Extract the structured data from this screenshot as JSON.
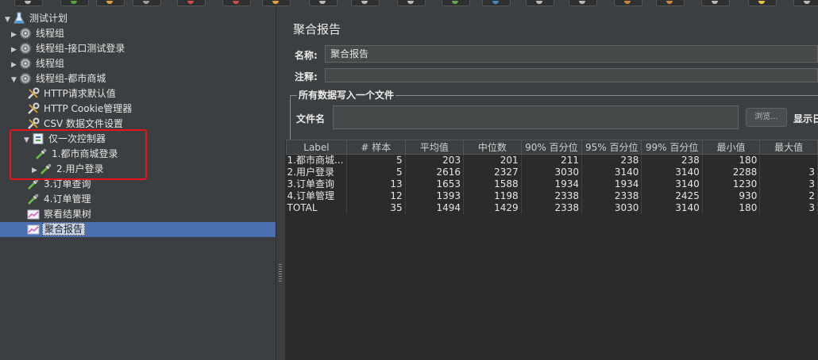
{
  "toolbar": {
    "buttons": [
      {
        "name": "new-plan-button",
        "accent": "#bbbbbb"
      },
      {
        "name": "templates-button",
        "accent": "#56a83a"
      },
      {
        "name": "open-button",
        "accent": "#d7a430"
      },
      {
        "name": "save-button",
        "accent": "#9a9a9a"
      },
      {
        "name": "cut-button",
        "accent": "#d14d4d"
      },
      {
        "name": "copy-button",
        "accent": "#d14d4d"
      },
      {
        "name": "paste-button",
        "accent": "#e2a43a"
      },
      {
        "name": "expand-button",
        "accent": "#bbbbbb"
      },
      {
        "name": "collapse-button",
        "accent": "#bbbbbb"
      },
      {
        "name": "toggle-button",
        "accent": "#bbbbbb"
      },
      {
        "name": "start-button",
        "accent": "#6aa84f"
      },
      {
        "name": "start-no-pause-button",
        "accent": "#4a86c8"
      },
      {
        "name": "stop-button",
        "accent": "#bbbbbb"
      },
      {
        "name": "shutdown-button",
        "accent": "#bbbbbb"
      },
      {
        "name": "clear-button",
        "accent": "#c88a3a"
      },
      {
        "name": "clear-all-button",
        "accent": "#c88a3a"
      },
      {
        "name": "search-button",
        "accent": "#bbbbbb"
      },
      {
        "name": "function-helper-button",
        "accent": "#e5c542"
      },
      {
        "name": "help-button",
        "accent": "#bbbbbb"
      }
    ]
  },
  "tree": {
    "items": [
      {
        "label": "测试计划",
        "icon": "test-plan-icon",
        "arrow": "expanded",
        "indent": 0
      },
      {
        "label": "线程组",
        "icon": "gear-icon",
        "arrow": "collapsed",
        "indent": 1
      },
      {
        "label": "线程组-接口测试登录",
        "icon": "gear-icon",
        "arrow": "collapsed",
        "indent": 1
      },
      {
        "label": "线程组",
        "icon": "gear-icon",
        "arrow": "collapsed",
        "indent": 1
      },
      {
        "label": "线程组-都市商城",
        "icon": "gear-icon",
        "arrow": "expanded",
        "indent": 1
      },
      {
        "label": "HTTP请求默认值",
        "icon": "wrench-icon",
        "arrow": "none",
        "indent": 2
      },
      {
        "label": "HTTP Cookie管理器",
        "icon": "wrench-icon",
        "arrow": "none",
        "indent": 2
      },
      {
        "label": "CSV 数据文件设置",
        "icon": "wrench-icon",
        "arrow": "none",
        "indent": 2
      },
      {
        "label": "仅一次控制器",
        "icon": "controller-icon",
        "arrow": "expanded",
        "indent": 2
      },
      {
        "label": "1.都市商城登录",
        "icon": "pipette-icon",
        "arrow": "none",
        "indent": 3
      },
      {
        "label": "2.用户登录",
        "icon": "pipette-icon",
        "arrow": "collapsed",
        "indent": 3
      },
      {
        "label": "3.订单查询",
        "icon": "pipette-icon",
        "arrow": "none",
        "indent": 2
      },
      {
        "label": "4.订单管理",
        "icon": "pipette-icon",
        "arrow": "none",
        "indent": 2
      },
      {
        "label": "察看结果树",
        "icon": "chart-icon",
        "arrow": "none",
        "indent": 2
      },
      {
        "label": "聚合报告",
        "icon": "chart-icon",
        "arrow": "none",
        "indent": 2,
        "selected": true
      }
    ]
  },
  "report": {
    "title": "聚合报告",
    "name_label": "名称:",
    "name_value": "聚合报告",
    "comment_label": "注释:",
    "comment_value": "",
    "file_group_title": "所有数据写入一个文件",
    "filename_label": "文件名",
    "filename_value": "",
    "browse_label": "浏览...",
    "display_label": "显示日"
  },
  "table": {
    "columns": [
      "Label",
      "# 样本",
      "平均值",
      "中位数",
      "90% 百分位",
      "95% 百分位",
      "99% 百分位",
      "最小值",
      "最大值"
    ],
    "rows": [
      [
        "1.都市商城...",
        "5",
        "203",
        "201",
        "211",
        "238",
        "238",
        "180",
        ""
      ],
      [
        "2.用户登录",
        "5",
        "2616",
        "2327",
        "3030",
        "3140",
        "3140",
        "2288",
        "3"
      ],
      [
        "3.订单查询",
        "13",
        "1653",
        "1588",
        "1934",
        "1934",
        "3140",
        "1230",
        "3"
      ],
      [
        "4.订单管理",
        "12",
        "1393",
        "1198",
        "2338",
        "2338",
        "2425",
        "930",
        "2"
      ],
      [
        "TOTAL",
        "35",
        "1494",
        "1429",
        "2338",
        "3030",
        "3140",
        "180",
        "3"
      ]
    ]
  },
  "colors": {
    "background": "#3c3f41",
    "table_background": "#2b2b2b",
    "selection": "#4b6eaf",
    "highlight_box": "#e8131b"
  }
}
